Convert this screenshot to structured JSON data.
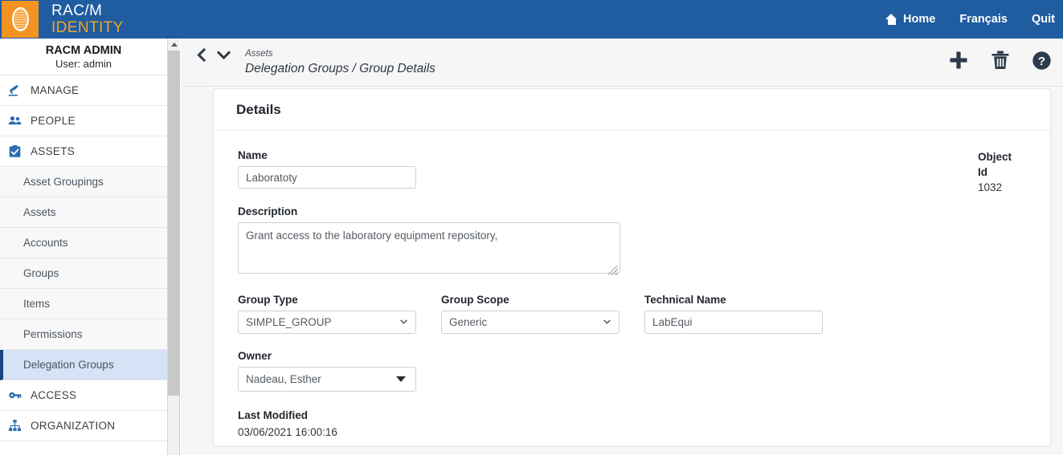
{
  "brand": {
    "line1": "RAC/M",
    "line2": "IDENTITY",
    "logo_icon": "fingerprint-icon",
    "logo_bg": "#f39422",
    "header_bg": "#1f5ca0"
  },
  "topnav": {
    "home": "Home",
    "home_icon": "home-icon",
    "language": "Français",
    "quit": "Quit"
  },
  "sidebar": {
    "user_name": "RACM ADMIN",
    "user_sub": "User: admin",
    "sections": [
      {
        "label": "MANAGE",
        "icon": "gavel-icon"
      },
      {
        "label": "PEOPLE",
        "icon": "people-icon"
      },
      {
        "label": "ASSETS",
        "icon": "clipboard-check-icon"
      }
    ],
    "asset_items": [
      {
        "label": "Asset Groupings",
        "active": false
      },
      {
        "label": "Assets",
        "active": false
      },
      {
        "label": "Accounts",
        "active": false
      },
      {
        "label": "Groups",
        "active": false
      },
      {
        "label": "Items",
        "active": false
      },
      {
        "label": "Permissions",
        "active": false
      },
      {
        "label": "Delegation Groups",
        "active": true
      }
    ],
    "sections_bottom": [
      {
        "label": "ACCESS",
        "icon": "key-icon"
      },
      {
        "label": "ORGANIZATION",
        "icon": "sitemap-icon"
      }
    ],
    "active_color": "#d6e2f5",
    "active_border": "#15477f"
  },
  "breadcrumb": {
    "parent": "Assets",
    "path": "Delegation Groups / Group Details",
    "back_icon": "chevron-left-icon",
    "expand_icon": "chevron-down-icon"
  },
  "actions": [
    {
      "name": "add-button",
      "icon": "plus-icon"
    },
    {
      "name": "delete-button",
      "icon": "trash-icon"
    },
    {
      "name": "help-button",
      "icon": "help-circle-icon"
    }
  ],
  "panel": {
    "title": "Details",
    "name": {
      "label": "Name",
      "value": "Laboratoty"
    },
    "description": {
      "label": "Description",
      "value": "Grant access to the laboratory equipment repository,"
    },
    "group_type": {
      "label": "Group Type",
      "value": "SIMPLE_GROUP"
    },
    "group_scope": {
      "label": "Group Scope",
      "value": "Generic"
    },
    "technical_name": {
      "label": "Technical Name",
      "value": "LabEqui"
    },
    "owner": {
      "label": "Owner",
      "value": "Nadeau, Esther"
    },
    "last_modified": {
      "label": "Last Modified",
      "value": "03/06/2021 16:00:16"
    },
    "object_id": {
      "label_line1": "Object",
      "label_line2": "Id",
      "value": "1032"
    }
  }
}
